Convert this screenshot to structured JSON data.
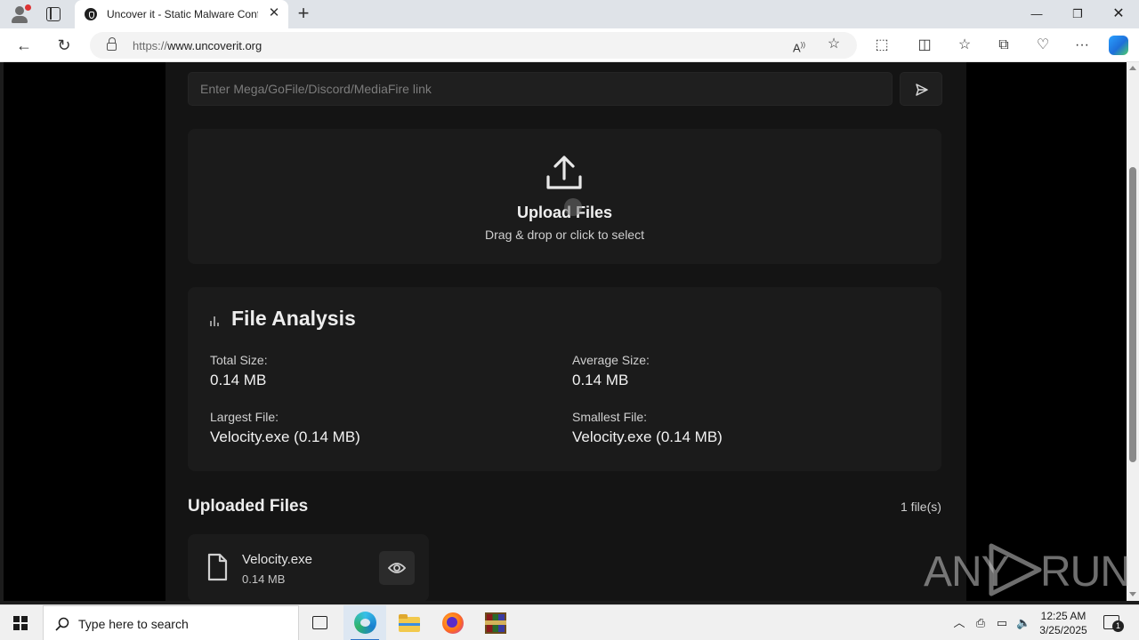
{
  "browser": {
    "tab_title": "Uncover it - Static Malware Confi",
    "url_protocol": "https://",
    "url_host": "www.uncoverit.org"
  },
  "page": {
    "link_placeholder": "Enter Mega/GoFile/Discord/MediaFire link",
    "upload_title": "Upload Files",
    "upload_subtitle": "Drag & drop or click to select",
    "analysis": {
      "title": "File Analysis",
      "total_size_label": "Total Size:",
      "total_size_value": "0.14 MB",
      "average_size_label": "Average Size:",
      "average_size_value": "0.14 MB",
      "largest_file_label": "Largest File:",
      "largest_file_value": "Velocity.exe (0.14 MB)",
      "smallest_file_label": "Smallest File:",
      "smallest_file_value": "Velocity.exe (0.14 MB)"
    },
    "uploaded_title": "Uploaded Files",
    "uploaded_count": "1 file(s)",
    "files": [
      {
        "name": "Velocity.exe",
        "size": "0.14 MB"
      }
    ]
  },
  "watermark": {
    "left": "ANY",
    "right": "RUN"
  },
  "taskbar": {
    "search_placeholder": "Type here to search",
    "time": "12:25 AM",
    "date": "3/25/2025",
    "notification_count": "1"
  },
  "colors": {
    "page_bg": "#000000",
    "panel_bg": "#1b1b1b",
    "content_bg": "#141414",
    "accent_taskbar": "#2b73c8"
  }
}
